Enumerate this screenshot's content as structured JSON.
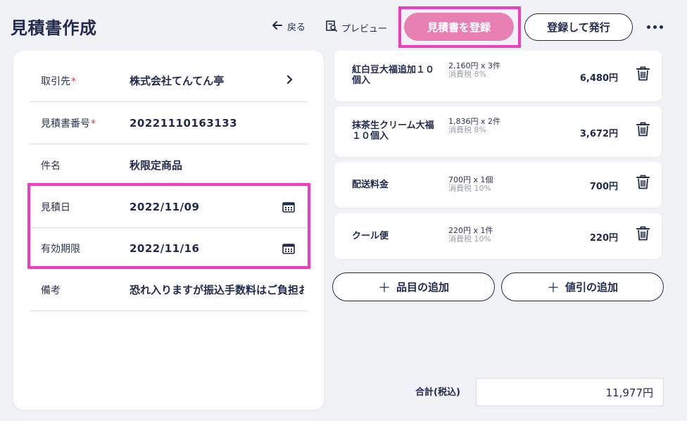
{
  "page": {
    "title": "見積書作成"
  },
  "toolbar": {
    "back_label": "戻る",
    "preview_label": "プレビュー",
    "register_label": "見積書を登録",
    "issue_label": "登録して発行"
  },
  "form": {
    "client": {
      "label": "取引先",
      "required": "*",
      "value": "株式会社てんてん亭"
    },
    "estimate_no": {
      "label": "見積書番号",
      "required": "*",
      "value": "20221110163133"
    },
    "subject": {
      "label": "件名",
      "value": "秋限定商品"
    },
    "estimate_date": {
      "label": "見積日",
      "value": "2022/11/09"
    },
    "valid_until": {
      "label": "有効期限",
      "value": "2022/11/16"
    },
    "notes": {
      "label": "備考",
      "value": "恐れ入りますが振込手数料はご負担お"
    }
  },
  "items": [
    {
      "name": "紅白豆大福追加１０個入",
      "detail": "2,160円 x 3件",
      "tax": "消費税 8%",
      "amount": "6,480円"
    },
    {
      "name": "抹茶生クリーム大福１０個入",
      "detail": "1,836円 x 2件",
      "tax": "消費税 8%",
      "amount": "3,672円"
    },
    {
      "name": "配送料金",
      "detail": "700円 x 1個",
      "tax": "消費税 10%",
      "amount": "700円"
    },
    {
      "name": "クール便",
      "detail": "220円 x 1件",
      "tax": "消費税 10%",
      "amount": "220円"
    }
  ],
  "actions": {
    "add_item_label": "品目の追加",
    "add_discount_label": "値引の追加",
    "plus": "＋"
  },
  "total": {
    "label": "合計(税込)",
    "value": "11,977円"
  },
  "colors": {
    "accent": "#1f2a4d",
    "register": "#e880b4",
    "highlight": "#f03cc0",
    "required": "#e8384f"
  }
}
